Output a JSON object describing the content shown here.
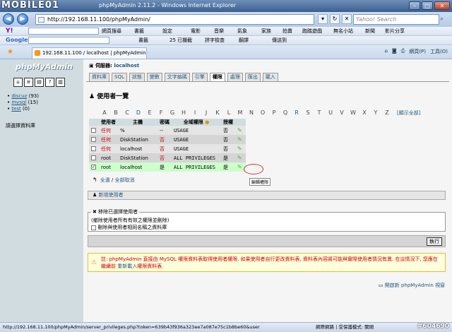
{
  "window": {
    "title": "phpMyAdmin 2.11.2 - Windows Internet Explorer",
    "logo": "MOBILE01"
  },
  "address": {
    "url": "http://192.168.11.100/phpMyAdmin/",
    "search_placeholder": "Yahoo! Search"
  },
  "toolbars": {
    "yahoo": {
      "brand": "Y!",
      "items": [
        "網頁搜尋",
        "書籤",
        "設定",
        "電影",
        "音樂",
        "氣象",
        "家族",
        "拍賣",
        "跑踏遊戲",
        "無名小站",
        "新聞",
        "影片分享"
      ]
    },
    "google": {
      "brand": "Google",
      "items": [
        "書籤",
        "25 已攔截",
        "拼字檢查",
        "翻譯",
        "傳送到"
      ]
    }
  },
  "tab": {
    "label": "192.168.11.100 / localhost | phpMyAdmin 2.1..."
  },
  "commandbar": {
    "items": [
      "網頁(P)",
      "工具(O)"
    ]
  },
  "sidebar": {
    "logo_php": "php",
    "logo_mya": "MyAdmin",
    "databases": [
      {
        "name": "discuz",
        "count": "(93)"
      },
      {
        "name": "mysql",
        "count": "(15)"
      },
      {
        "name": "test",
        "count": "(0)"
      }
    ],
    "hint": "請選擇資料庫"
  },
  "main": {
    "server_label": "伺服器:",
    "server_name": "localhost",
    "tabs": [
      "資料庫",
      "SQL",
      "狀態",
      "變數",
      "文字編碼",
      "引擎",
      "權限",
      "處理",
      "匯出",
      "載入"
    ],
    "heading": "使用者一覽",
    "letters": [
      "A",
      "B",
      "C",
      "D",
      "E",
      "F",
      "G",
      "H",
      "I",
      "J",
      "K",
      "L",
      "M",
      "N",
      "O",
      "P",
      "Q",
      "R",
      "S",
      "T",
      "U",
      "V",
      "W",
      "X",
      "Y",
      "Z"
    ],
    "show_all": "[顯示全部]",
    "columns": [
      "",
      "使用者",
      "主機",
      "密碼",
      "全域權限",
      "授權",
      ""
    ],
    "rows": [
      {
        "checked": "",
        "user": "任何",
        "host": "%",
        "password": "--",
        "privs": "USAGE",
        "grant": "否"
      },
      {
        "checked": "",
        "user": "任何",
        "host": "DiskStation",
        "password": "否",
        "privs": "USAGE",
        "grant": "否"
      },
      {
        "checked": "",
        "user": "任何",
        "host": "localhost",
        "password": "否",
        "privs": "USAGE",
        "grant": "否"
      },
      {
        "checked": "",
        "user": "root",
        "host": "DiskStation",
        "password": "否",
        "privs": "ALL PRIVILEGES",
        "grant": "是"
      },
      {
        "checked": "✓",
        "user": "root",
        "host": "localhost",
        "password": "是",
        "privs": "ALL PRIVILEGES",
        "grant": "是"
      }
    ],
    "tooltip": "編輯權限",
    "check_all": "全選",
    "uncheck_all": "全部取消",
    "sep": " / ",
    "add_user": "新增使用者",
    "delete_legend": "移除已選擇使用者",
    "delete_note": "(撤除使用者所有有效之權限並刪除)",
    "delete_checkbox": "刪除與使用者相同名稱之資料庫",
    "go_button": "執行",
    "notice_text": "註: phpMyAdmin 直接由 MySQL 權限資料表取得使用者權限. 如果使用者自行更改資料表, 資料表內容將可能與實際使用者情況有異. 在這情況下, 您應在繼續前",
    "notice_link": "重新載入",
    "notice_tail": "權限資料表.",
    "new_window": "開啟新 phpMyAdmin 視窗"
  },
  "statusbar": {
    "url": "http://192.168.11.100/phpMyAdmin/server_privileges.php?token=639b43f936a323ee7a087e75c1b8be60&user",
    "zone": "網際網路 | 受保護模式: 關閉",
    "watermark": "#604690"
  }
}
